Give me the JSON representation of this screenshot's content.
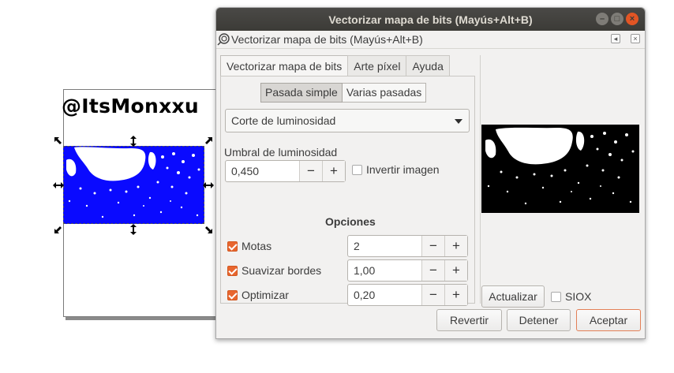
{
  "canvas": {
    "watermark": "@ItsMonxxu",
    "bitmap_color": "#0a0aff"
  },
  "window": {
    "title": "Vectorizar mapa de bits (Mayús+Alt+B)",
    "buttons": {
      "minimize": "–",
      "maximize": "□",
      "close": "×"
    }
  },
  "dock": {
    "title": "Vectorizar mapa de bits (Mayús+Alt+B)",
    "icon": "trace-bitmap-icon"
  },
  "tabs": [
    "Vectorizar mapa de bits",
    "Arte píxel",
    "Ayuda"
  ],
  "modes": {
    "single": "Pasada simple",
    "multi": "Varias pasadas"
  },
  "method": {
    "selected": "Corte de luminosidad"
  },
  "threshold": {
    "label": "Umbral de luminosidad",
    "value": "0,450",
    "minus": "−",
    "plus": "+"
  },
  "invert": {
    "label": "Invertir imagen",
    "checked": false
  },
  "options": {
    "title": "Opciones",
    "items": [
      {
        "label": "Motas",
        "value": "2",
        "checked": true
      },
      {
        "label": "Suavizar bordes",
        "value": "1,00",
        "checked": true
      },
      {
        "label": "Optimizar",
        "value": "0,20",
        "checked": true
      }
    ],
    "minus": "−",
    "plus": "+"
  },
  "preview": {
    "update_label": "Actualizar",
    "siox_label": "SIOX",
    "siox_checked": false
  },
  "footer": {
    "revert": "Revertir",
    "stop": "Detener",
    "accept": "Aceptar"
  },
  "colors": {
    "accent": "#e8662f",
    "titlebar": "#3c3b37"
  }
}
